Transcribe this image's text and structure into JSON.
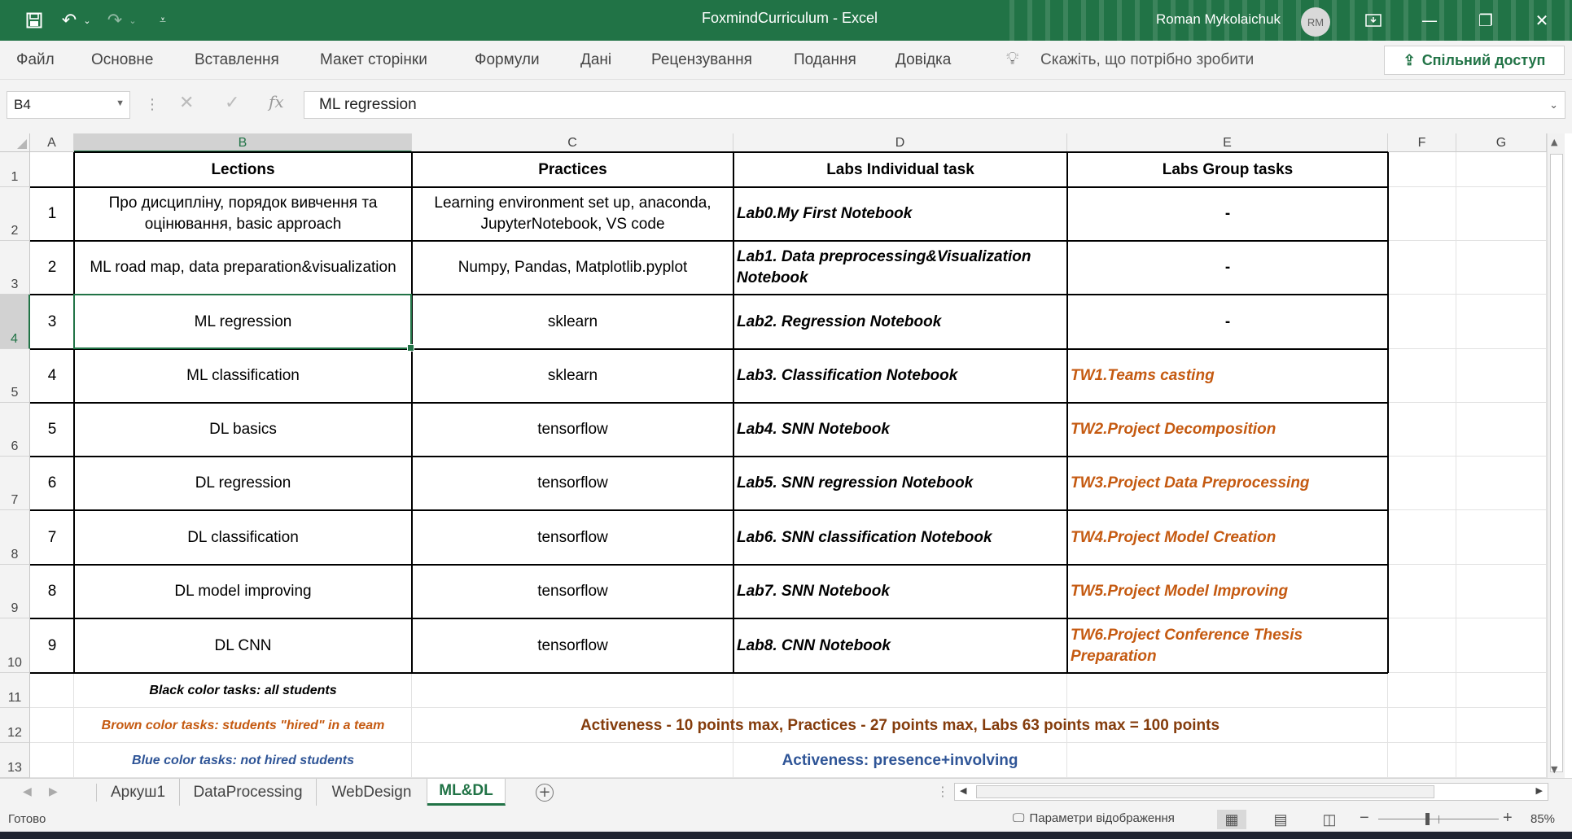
{
  "app": {
    "title": "FoxmindCurriculum  -  Excel",
    "user": "Roman Mykolaichuk",
    "avatar_initials": "RM",
    "accent_color": "#217346"
  },
  "ribbon": {
    "tabs": [
      "Файл",
      "Основне",
      "Вставлення",
      "Макет сторінки",
      "Формули",
      "Дані",
      "Рецензування",
      "Подання",
      "Довідка"
    ],
    "tell_me": "Скажіть, що потрібно зробити",
    "share": "Спільний доступ"
  },
  "formula_bar": {
    "name_box": "B4",
    "fx_label": "fx",
    "content": "ML regression"
  },
  "grid": {
    "columns": [
      "A",
      "B",
      "C",
      "D",
      "E",
      "F",
      "G"
    ],
    "rows": [
      "1",
      "2",
      "3",
      "4",
      "5",
      "6",
      "7",
      "8",
      "9",
      "10",
      "11",
      "12",
      "13"
    ],
    "header": {
      "lections": "Lections",
      "practices": "Practices",
      "labs_individual": "Labs Individual task",
      "labs_group": "Labs Group tasks"
    },
    "data": [
      {
        "n": "1",
        "lection": "Про дисципліну, порядок вивчення та оцінювання, basic approach",
        "practice": "Learning environment set up, anaconda, JupyterNotebook, VS code",
        "lab": "Lab0.My First Notebook",
        "group": "-"
      },
      {
        "n": "2",
        "lection": "ML road map, data preparation&visualization",
        "practice": "Numpy, Pandas, Matplotlib.pyplot",
        "lab": "Lab1. Data preprocessing&Visualization Notebook",
        "group": "-"
      },
      {
        "n": "3",
        "lection": "ML regression",
        "practice": "sklearn",
        "lab": "Lab2. Regression Notebook",
        "group": "-"
      },
      {
        "n": "4",
        "lection": "ML classification",
        "practice": "sklearn",
        "lab": "Lab3. Classification Notebook",
        "group": "TW1.Teams casting"
      },
      {
        "n": "5",
        "lection": "DL basics",
        "practice": "tensorflow",
        "lab": "Lab4. SNN Notebook",
        "group": "TW2.Project Decomposition"
      },
      {
        "n": "6",
        "lection": "DL regression",
        "practice": "tensorflow",
        "lab": "Lab5. SNN regression Notebook",
        "group": "TW3.Project  Data Preprocessing"
      },
      {
        "n": "7",
        "lection": "DL classification",
        "practice": "tensorflow",
        "lab": "Lab6. SNN classification Notebook",
        "group": "TW4.Project  Model Creation"
      },
      {
        "n": "8",
        "lection": "DL model improving",
        "practice": "tensorflow",
        "lab": "Lab7. SNN Notebook",
        "group": "TW5.Project Model Improving"
      },
      {
        "n": "9",
        "lection": "DL CNN",
        "practice": "tensorflow",
        "lab": "Lab8. CNN Notebook",
        "group": "TW6.Project  Conference Thesis Preparation"
      }
    ],
    "legend": {
      "black": "Black color tasks: all students",
      "brown": "Brown color tasks: students \"hired\" in a team",
      "blue": "Blue color tasks: not hired students"
    },
    "notes": {
      "points": "Activeness - 10 points max, Practices - 27 points max, Labs 63 points max = 100 points",
      "activeness": "Activeness: presence+involving"
    },
    "colors": {
      "brown": "#c55a11",
      "dark_brown": "#843c0c",
      "blue": "#2f5597"
    }
  },
  "sheets": {
    "tabs": [
      "Аркуш1",
      "DataProcessing",
      "WebDesign",
      "ML&DL"
    ],
    "active": "ML&DL"
  },
  "status": {
    "ready": "Готово",
    "display_settings": "Параметри відображення",
    "zoom": "85%"
  }
}
